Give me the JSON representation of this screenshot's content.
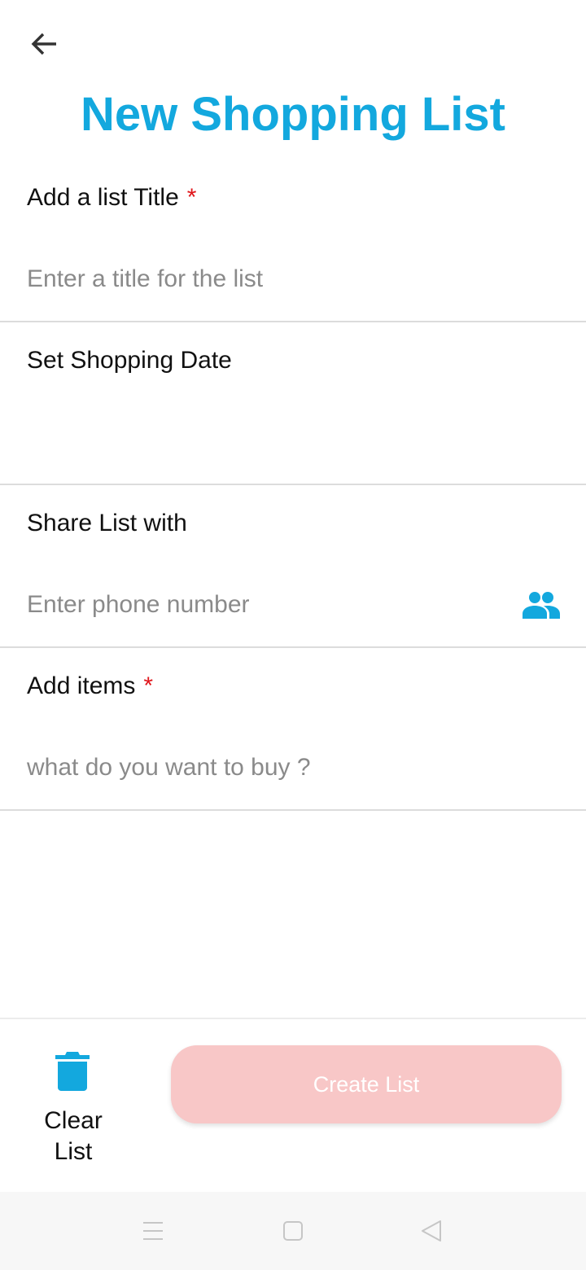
{
  "header": {
    "back_icon": "arrow-left-icon",
    "title": "New Shopping List"
  },
  "colors": {
    "accent": "#13a8de",
    "required": "#e0161b",
    "create_button_disabled": "#f8c7c7"
  },
  "form": {
    "title_field": {
      "label": "Add a list Title",
      "required_mark": "*",
      "value": "",
      "placeholder": "Enter a title for the list"
    },
    "date_field": {
      "label": "Set Shopping Date"
    },
    "share_field": {
      "label": "Share List with",
      "value": "",
      "placeholder": "Enter phone number",
      "icon": "contacts-icon"
    },
    "items_field": {
      "label": "Add items",
      "required_mark": "*",
      "value": "",
      "placeholder": "what do you want to buy ?"
    }
  },
  "footer": {
    "clear_icon": "trash-icon",
    "clear_label_line1": "Clear",
    "clear_label_line2": "List",
    "create_label": "Create List"
  },
  "system_nav": {
    "menu_icon": "menu-icon",
    "home_icon": "home-square-icon",
    "back_icon": "back-triangle-icon"
  }
}
